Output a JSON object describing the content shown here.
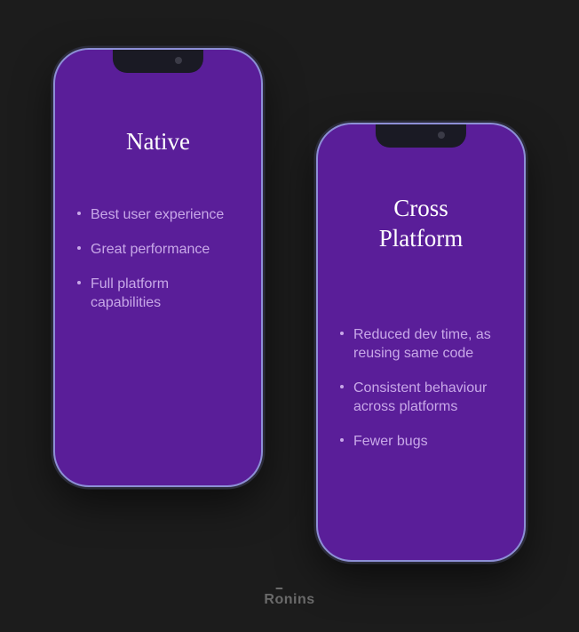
{
  "phones": {
    "left": {
      "title": "Native",
      "items": [
        "Best user experience",
        "Great performance",
        "Full platform capabilities"
      ]
    },
    "right": {
      "title_line1": "Cross",
      "title_line2": "Platform",
      "items": [
        "Reduced dev time, as reusing same code",
        "Consistent behaviour across platforms",
        "Fewer bugs"
      ]
    }
  },
  "logo": "Ronins"
}
